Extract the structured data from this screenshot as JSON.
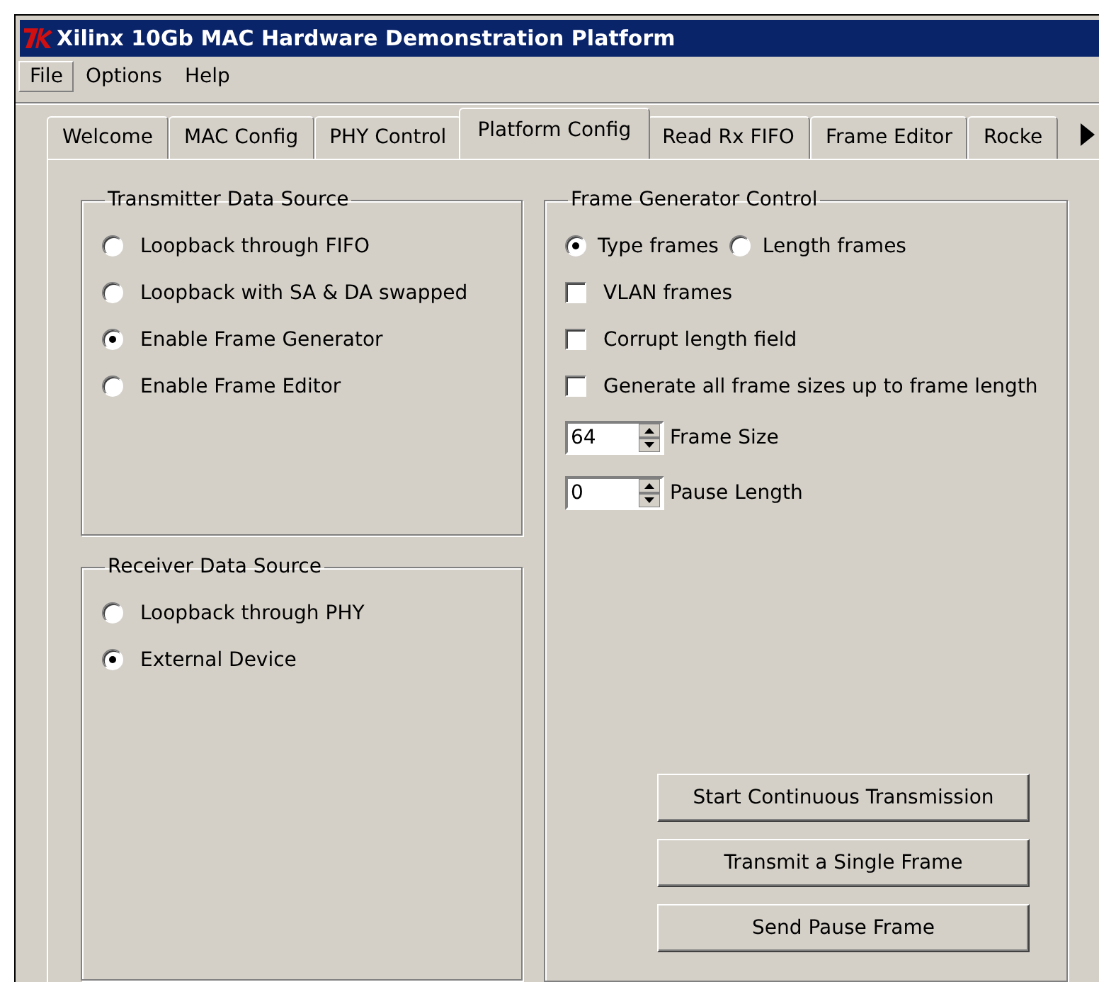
{
  "window": {
    "title": "Xilinx 10Gb MAC Hardware Demonstration Platform"
  },
  "menu": [
    {
      "label": "File",
      "selected": true
    },
    {
      "label": "Options",
      "selected": false
    },
    {
      "label": "Help",
      "selected": false
    }
  ],
  "tabs": [
    {
      "label": "Welcome",
      "selected": false
    },
    {
      "label": "MAC Config",
      "selected": false
    },
    {
      "label": "PHY Control",
      "selected": false
    },
    {
      "label": "Platform Config",
      "selected": true
    },
    {
      "label": "Read Rx FIFO",
      "selected": false
    },
    {
      "label": "Frame Editor",
      "selected": false
    },
    {
      "label": "Rocke",
      "selected": false
    }
  ],
  "transmitter_data_source": {
    "title": "Transmitter Data Source",
    "options": [
      {
        "label": "Loopback through FIFO",
        "selected": false
      },
      {
        "label": "Loopback with SA & DA swapped",
        "selected": false
      },
      {
        "label": "Enable Frame Generator",
        "selected": true
      },
      {
        "label": "Enable Frame Editor",
        "selected": false
      }
    ]
  },
  "receiver_data_source": {
    "title": "Receiver Data Source",
    "options": [
      {
        "label": "Loopback through PHY",
        "selected": false
      },
      {
        "label": "External Device",
        "selected": true
      }
    ]
  },
  "frame_generator_control": {
    "title": "Frame Generator Control",
    "frame_type": [
      {
        "label": "Type frames",
        "selected": true
      },
      {
        "label": "Length frames",
        "selected": false
      }
    ],
    "checkboxes": [
      {
        "label": "VLAN frames",
        "checked": false
      },
      {
        "label": "Corrupt length field",
        "checked": false
      },
      {
        "label": "Generate all frame sizes up to frame length",
        "checked": false
      }
    ],
    "spinners": [
      {
        "value": "64",
        "label": "Frame Size"
      },
      {
        "value": "0",
        "label": "Pause Length"
      }
    ],
    "buttons": [
      "Start Continuous Transmission",
      "Transmit a Single Frame",
      "Send Pause Frame"
    ]
  }
}
